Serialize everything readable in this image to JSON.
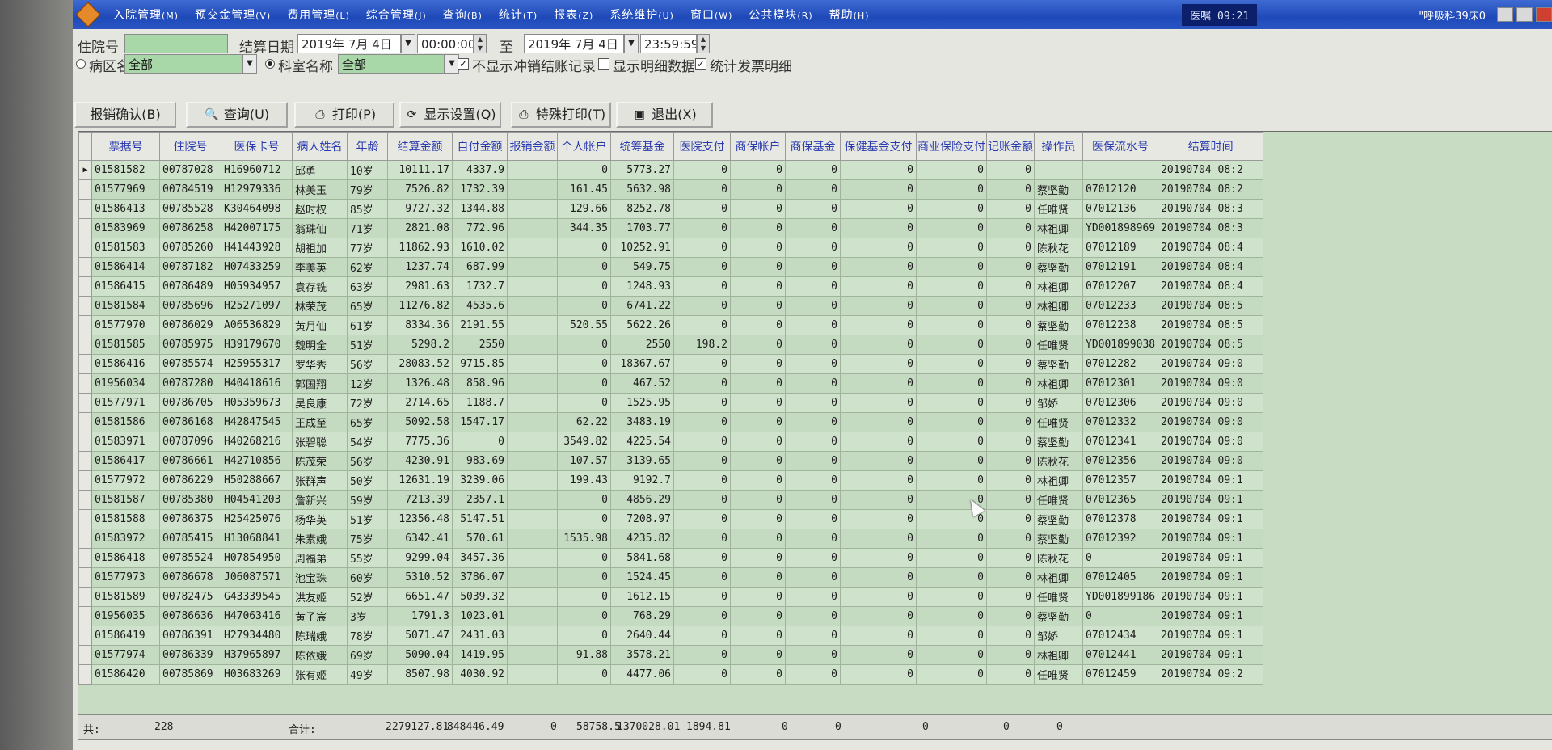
{
  "menubar": {
    "items": [
      {
        "label": "入院管理",
        "key": "(M)"
      },
      {
        "label": "预交金管理",
        "key": "(V)"
      },
      {
        "label": "费用管理",
        "key": "(L)"
      },
      {
        "label": "综合管理",
        "key": "(J)"
      },
      {
        "label": "查询",
        "key": "(B)"
      },
      {
        "label": "统计",
        "key": "(T)"
      },
      {
        "label": "报表",
        "key": "(Z)"
      },
      {
        "label": "系统维护",
        "key": "(U)"
      },
      {
        "label": "窗口",
        "key": "(W)"
      },
      {
        "label": "公共模块",
        "key": "(R)"
      },
      {
        "label": "帮助",
        "key": "(H)"
      }
    ],
    "status_text": "医嘱 09:21",
    "user_text": "\"呼吸科39床0"
  },
  "filters": {
    "inpatient_no_label": "住院号",
    "inpatient_no_value": "",
    "settle_date_label": "结算日期",
    "date_from": "2019年 7月 4日",
    "time_from": "00:00:00",
    "to_label": "至",
    "date_to": "2019年 7月 4日",
    "time_to": "23:59:59",
    "ward_label": "病区名称",
    "ward_value": "全部",
    "dept_label": "科室名称",
    "dept_value": "全部",
    "opt1_label": "不显示冲销结账记录",
    "opt2_label": "显示明细数据",
    "opt3_label": "统计发票明细"
  },
  "toolbar": {
    "confirm": "报销确认(B)",
    "query": "查询(U)",
    "print": "打印(P)",
    "display": "显示设置(Q)",
    "special_print": "特殊打印(T)",
    "exit": "退出(X)"
  },
  "table": {
    "columns": [
      "票据号",
      "住院号",
      "医保卡号",
      "病人姓名",
      "年龄",
      "结算金额",
      "自付金额",
      "报销金额",
      "个人帐户",
      "统筹基金",
      "医院支付",
      "商保帐户",
      "商保基金",
      "保健基金支付",
      "商业保险支付",
      "记账金额",
      "操作员",
      "医保流水号",
      "结算时间"
    ],
    "rows": [
      [
        "01581582",
        "00787028",
        "H16960712",
        "邱勇",
        "10岁",
        "10111.17",
        "4337.9",
        "",
        "0",
        "5773.27",
        "0",
        "0",
        "0",
        "0",
        "0",
        "0",
        "",
        "",
        "20190704 08:2"
      ],
      [
        "01577969",
        "00784519",
        "H12979336",
        "林美玉",
        "79岁",
        "7526.82",
        "1732.39",
        "",
        "161.45",
        "5632.98",
        "0",
        "0",
        "0",
        "0",
        "0",
        "0",
        "蔡坚勤",
        "07012120",
        "20190704 08:2"
      ],
      [
        "01586413",
        "00785528",
        "K30464098",
        "赵时权",
        "85岁",
        "9727.32",
        "1344.88",
        "",
        "129.66",
        "8252.78",
        "0",
        "0",
        "0",
        "0",
        "0",
        "0",
        "任唯贤",
        "07012136",
        "20190704 08:3"
      ],
      [
        "01583969",
        "00786258",
        "H42007175",
        "翁珠仙",
        "71岁",
        "2821.08",
        "772.96",
        "",
        "344.35",
        "1703.77",
        "0",
        "0",
        "0",
        "0",
        "0",
        "0",
        "林祖卿",
        "YD001898969",
        "20190704 08:3"
      ],
      [
        "01581583",
        "00785260",
        "H41443928",
        "胡祖加",
        "77岁",
        "11862.93",
        "1610.02",
        "",
        "0",
        "10252.91",
        "0",
        "0",
        "0",
        "0",
        "0",
        "0",
        "陈秋花",
        "07012189",
        "20190704 08:4"
      ],
      [
        "01586414",
        "00787182",
        "H07433259",
        "李美英",
        "62岁",
        "1237.74",
        "687.99",
        "",
        "0",
        "549.75",
        "0",
        "0",
        "0",
        "0",
        "0",
        "0",
        "蔡坚勤",
        "07012191",
        "20190704 08:4"
      ],
      [
        "01586415",
        "00786489",
        "H05934957",
        "袁存铣",
        "63岁",
        "2981.63",
        "1732.7",
        "",
        "0",
        "1248.93",
        "0",
        "0",
        "0",
        "0",
        "0",
        "0",
        "林祖卿",
        "07012207",
        "20190704 08:4"
      ],
      [
        "01581584",
        "00785696",
        "H25271097",
        "林荣茂",
        "65岁",
        "11276.82",
        "4535.6",
        "",
        "0",
        "6741.22",
        "0",
        "0",
        "0",
        "0",
        "0",
        "0",
        "林祖卿",
        "07012233",
        "20190704 08:5"
      ],
      [
        "01577970",
        "00786029",
        "A06536829",
        "黄月仙",
        "61岁",
        "8334.36",
        "2191.55",
        "",
        "520.55",
        "5622.26",
        "0",
        "0",
        "0",
        "0",
        "0",
        "0",
        "蔡坚勤",
        "07012238",
        "20190704 08:5"
      ],
      [
        "01581585",
        "00785975",
        "H39179670",
        "魏明全",
        "51岁",
        "5298.2",
        "2550",
        "",
        "0",
        "2550",
        "198.2",
        "0",
        "0",
        "0",
        "0",
        "0",
        "任唯贤",
        "YD001899038",
        "20190704 08:5"
      ],
      [
        "01586416",
        "00785574",
        "H25955317",
        "罗华秀",
        "56岁",
        "28083.52",
        "9715.85",
        "",
        "0",
        "18367.67",
        "0",
        "0",
        "0",
        "0",
        "0",
        "0",
        "蔡坚勤",
        "07012282",
        "20190704 09:0"
      ],
      [
        "01956034",
        "00787280",
        "H40418616",
        "郭国翔",
        "12岁",
        "1326.48",
        "858.96",
        "",
        "0",
        "467.52",
        "0",
        "0",
        "0",
        "0",
        "0",
        "0",
        "林祖卿",
        "07012301",
        "20190704 09:0"
      ],
      [
        "01577971",
        "00786705",
        "H05359673",
        "吴良康",
        "72岁",
        "2714.65",
        "1188.7",
        "",
        "0",
        "1525.95",
        "0",
        "0",
        "0",
        "0",
        "0",
        "0",
        "邹娇",
        "07012306",
        "20190704 09:0"
      ],
      [
        "01581586",
        "00786168",
        "H42847545",
        "王成至",
        "65岁",
        "5092.58",
        "1547.17",
        "",
        "62.22",
        "3483.19",
        "0",
        "0",
        "0",
        "0",
        "0",
        "0",
        "任唯贤",
        "07012332",
        "20190704 09:0"
      ],
      [
        "01583971",
        "00787096",
        "H40268216",
        "张碧聪",
        "54岁",
        "7775.36",
        "0",
        "",
        "3549.82",
        "4225.54",
        "0",
        "0",
        "0",
        "0",
        "0",
        "0",
        "蔡坚勤",
        "07012341",
        "20190704 09:0"
      ],
      [
        "01586417",
        "00786661",
        "H42710856",
        "陈茂荣",
        "56岁",
        "4230.91",
        "983.69",
        "",
        "107.57",
        "3139.65",
        "0",
        "0",
        "0",
        "0",
        "0",
        "0",
        "陈秋花",
        "07012356",
        "20190704 09:0"
      ],
      [
        "01577972",
        "00786229",
        "H50288667",
        "张群声",
        "50岁",
        "12631.19",
        "3239.06",
        "",
        "199.43",
        "9192.7",
        "0",
        "0",
        "0",
        "0",
        "0",
        "0",
        "林祖卿",
        "07012357",
        "20190704 09:1"
      ],
      [
        "01581587",
        "00785380",
        "H04541203",
        "詹新兴",
        "59岁",
        "7213.39",
        "2357.1",
        "",
        "0",
        "4856.29",
        "0",
        "0",
        "0",
        "0",
        "0",
        "0",
        "任唯贤",
        "07012365",
        "20190704 09:1"
      ],
      [
        "01581588",
        "00786375",
        "H25425076",
        "杨华英",
        "51岁",
        "12356.48",
        "5147.51",
        "",
        "0",
        "7208.97",
        "0",
        "0",
        "0",
        "0",
        "0",
        "0",
        "蔡坚勤",
        "07012378",
        "20190704 09:1"
      ],
      [
        "01583972",
        "00785415",
        "H13068841",
        "朱素娥",
        "75岁",
        "6342.41",
        "570.61",
        "",
        "1535.98",
        "4235.82",
        "0",
        "0",
        "0",
        "0",
        "0",
        "0",
        "蔡坚勤",
        "07012392",
        "20190704 09:1"
      ],
      [
        "01586418",
        "00785524",
        "H07854950",
        "周福弟",
        "55岁",
        "9299.04",
        "3457.36",
        "",
        "0",
        "5841.68",
        "0",
        "0",
        "0",
        "0",
        "0",
        "0",
        "陈秋花",
        "0",
        "20190704 09:1"
      ],
      [
        "01577973",
        "00786678",
        "J06087571",
        "池宝珠",
        "60岁",
        "5310.52",
        "3786.07",
        "",
        "0",
        "1524.45",
        "0",
        "0",
        "0",
        "0",
        "0",
        "0",
        "林祖卿",
        "07012405",
        "20190704 09:1"
      ],
      [
        "01581589",
        "00782475",
        "G43339545",
        "洪友姬",
        "52岁",
        "6651.47",
        "5039.32",
        "",
        "0",
        "1612.15",
        "0",
        "0",
        "0",
        "0",
        "0",
        "0",
        "任唯贤",
        "YD001899186",
        "20190704 09:1"
      ],
      [
        "01956035",
        "00786636",
        "H47063416",
        "黄子宸",
        "3岁",
        "1791.3",
        "1023.01",
        "",
        "0",
        "768.29",
        "0",
        "0",
        "0",
        "0",
        "0",
        "0",
        "蔡坚勤",
        "0",
        "20190704 09:1"
      ],
      [
        "01586419",
        "00786391",
        "H27934480",
        "陈瑞娥",
        "78岁",
        "5071.47",
        "2431.03",
        "",
        "0",
        "2640.44",
        "0",
        "0",
        "0",
        "0",
        "0",
        "0",
        "邹娇",
        "07012434",
        "20190704 09:1"
      ],
      [
        "01577974",
        "00786339",
        "H37965897",
        "陈依娥",
        "69岁",
        "5090.04",
        "1419.95",
        "",
        "91.88",
        "3578.21",
        "0",
        "0",
        "0",
        "0",
        "0",
        "0",
        "林祖卿",
        "07012441",
        "20190704 09:1"
      ],
      [
        "01586420",
        "00785869",
        "H03683269",
        "张有姬",
        "49岁",
        "8507.98",
        "4030.92",
        "",
        "0",
        "4477.06",
        "0",
        "0",
        "0",
        "0",
        "0",
        "0",
        "任唯贤",
        "07012459",
        "20190704 09:2"
      ]
    ]
  },
  "footer": {
    "count_label": "共:",
    "count": "228",
    "total_label": "合计:",
    "total_amount": "2279127.81",
    "total_self": "848446.49",
    "total_reimburse": "0",
    "total_personal": "58758.5",
    "total_pool": "1370028.01",
    "total_hospital": "1894.81",
    "total_z1": "0",
    "total_z2": "0",
    "total_z3": "0",
    "total_z4": "0",
    "total_z5": "0"
  }
}
